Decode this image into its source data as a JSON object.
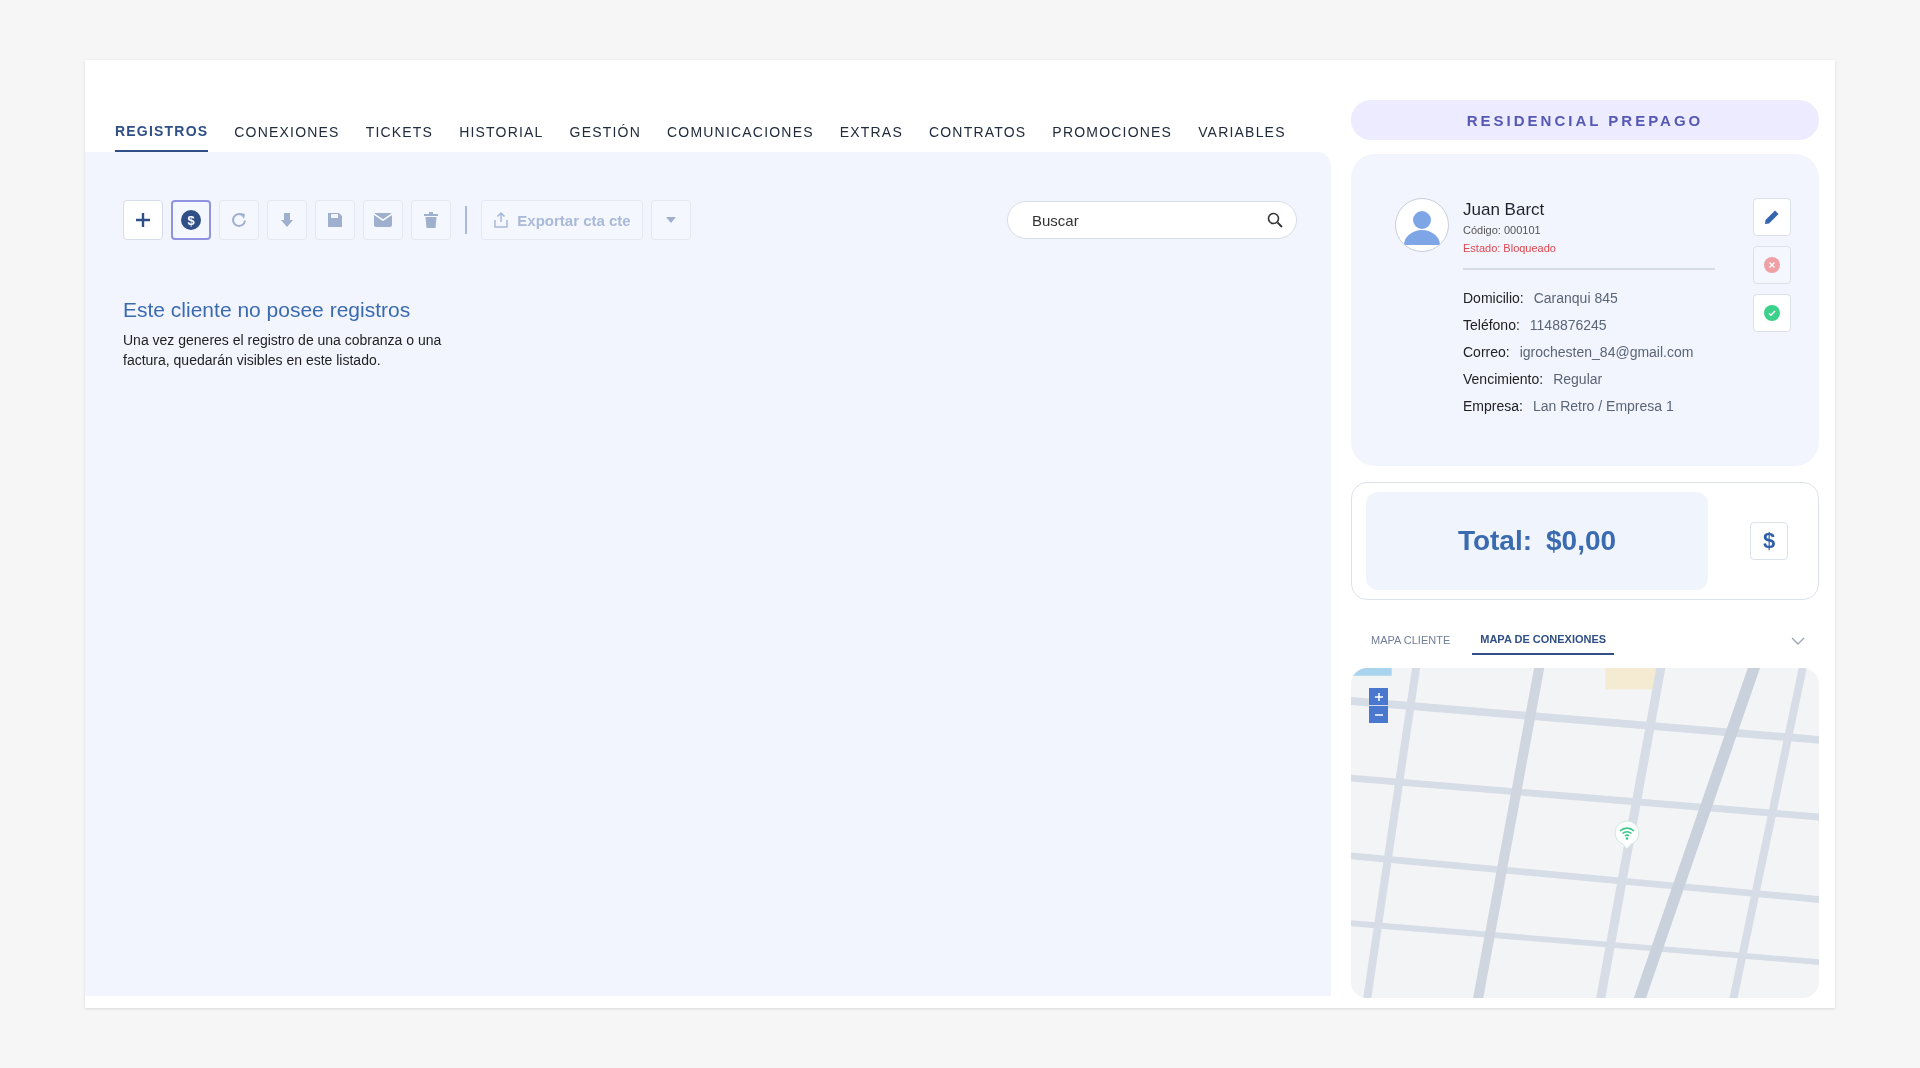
{
  "tabs": [
    {
      "label": "REGISTROS",
      "selected": true
    },
    {
      "label": "CONEXIONES",
      "selected": false
    },
    {
      "label": "TICKETS",
      "selected": false
    },
    {
      "label": "HISTORIAL",
      "selected": false
    },
    {
      "label": "GESTIÓN",
      "selected": false
    },
    {
      "label": "COMUNICACIONES",
      "selected": false
    },
    {
      "label": "EXTRAS",
      "selected": false
    },
    {
      "label": "CONTRATOS",
      "selected": false
    },
    {
      "label": "PROMOCIONES",
      "selected": false
    },
    {
      "label": "VARIABLES",
      "selected": false
    }
  ],
  "toolbar": {
    "tools": [
      {
        "kind": "add",
        "selected": false
      },
      {
        "kind": "payment",
        "selected": true,
        "symbol": "$"
      },
      {
        "kind": "refresh",
        "selected": false
      },
      {
        "kind": "download",
        "selected": false
      },
      {
        "kind": "save",
        "selected": false
      },
      {
        "kind": "email",
        "selected": false
      },
      {
        "kind": "delete",
        "selected": false
      }
    ],
    "export_label": "Exportar cta cte"
  },
  "search": {
    "placeholder": "Buscar"
  },
  "empty_state": {
    "title": "Este cliente no posee registros",
    "message": "Una vez generes el registro de una cobranza o una factura, quedarán visibles en este listado."
  },
  "plan": "RESIDENCIAL PREPAGO",
  "client": {
    "name": "Juan Barct",
    "code": "Código: 000101",
    "status": "Estado: Bloqueado",
    "fields": [
      {
        "label": "Domicilio:",
        "value": "Caranqui 845"
      },
      {
        "label": "Teléfono:",
        "value": "1148876245"
      },
      {
        "label": "Correo:",
        "value": "igrochesten_84@gmail.com"
      },
      {
        "label": "Vencimiento:",
        "value": "Regular"
      },
      {
        "label": "Empresa:",
        "value": "Lan Retro / Empresa 1"
      }
    ],
    "actions": [
      {
        "kind": "edit"
      },
      {
        "kind": "block"
      },
      {
        "kind": "activate"
      }
    ]
  },
  "total": {
    "label": "Total:",
    "value": "$0,00",
    "button": "$"
  },
  "map_tabs": [
    {
      "label": "MAPA CLIENTE",
      "selected": false
    },
    {
      "label": "MAPA DE CONEXIONES",
      "selected": true
    }
  ]
}
